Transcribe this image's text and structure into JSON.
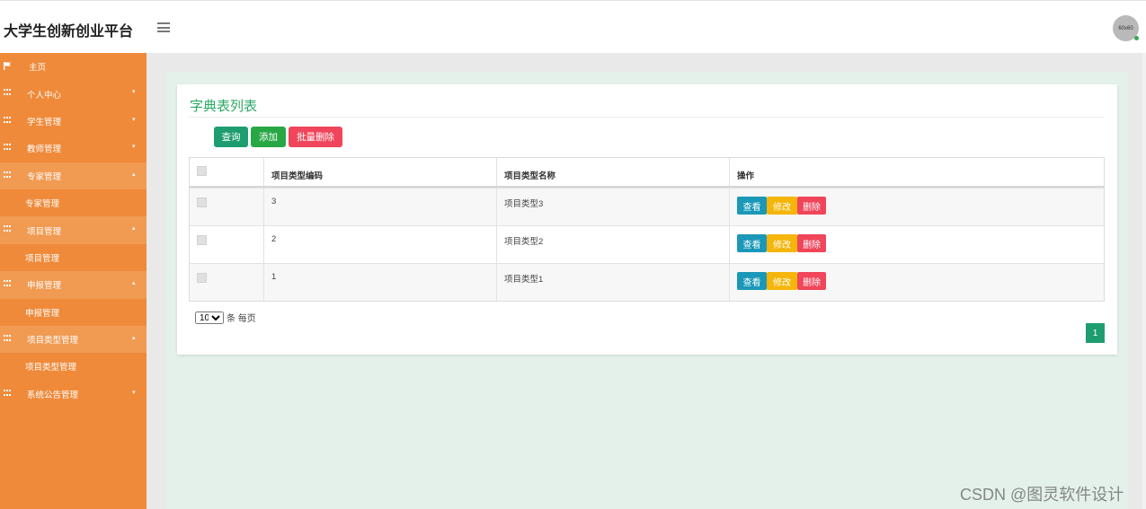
{
  "header": {
    "app_title": "大学生创新创业平台",
    "avatar_text": "60x60"
  },
  "sidebar": {
    "items": [
      {
        "label": "主页",
        "icon": "flag-icon",
        "type": "home"
      },
      {
        "label": "个人中心",
        "icon": "grid-icon",
        "chevron": "▾"
      },
      {
        "label": "学生管理",
        "icon": "grid-icon",
        "chevron": "▾"
      },
      {
        "label": "教师管理",
        "icon": "grid-icon",
        "chevron": "▾"
      },
      {
        "label": "专家管理",
        "icon": "grid-icon",
        "chevron": "▴",
        "open": true
      },
      {
        "label": "专家管理",
        "type": "sub"
      },
      {
        "label": "项目管理",
        "icon": "grid-icon",
        "chevron": "▴",
        "open": true
      },
      {
        "label": "项目管理",
        "type": "sub"
      },
      {
        "label": "申报管理",
        "icon": "grid-icon",
        "chevron": "▴",
        "open": true
      },
      {
        "label": "申报管理",
        "type": "sub"
      },
      {
        "label": "项目类型管理",
        "icon": "grid-icon",
        "chevron": "▴",
        "open": true
      },
      {
        "label": "项目类型管理",
        "type": "sub"
      },
      {
        "label": "系统公告管理",
        "icon": "grid-icon",
        "chevron": "▾"
      }
    ]
  },
  "main": {
    "title": "字典表列表",
    "buttons": {
      "query": "查询",
      "add": "添加",
      "batch_delete": "批量删除"
    },
    "table": {
      "columns": [
        "项目类型编码",
        "项目类型名称",
        "操作"
      ],
      "rows": [
        {
          "code": "3",
          "name": "项目类型3"
        },
        {
          "code": "2",
          "name": "项目类型2"
        },
        {
          "code": "1",
          "name": "项目类型1"
        }
      ],
      "actions": {
        "view": "查看",
        "edit": "修改",
        "delete": "删除"
      }
    },
    "pagination": {
      "page_size": "10",
      "page_size_options": [
        "10"
      ],
      "per_page_label": "条 每页",
      "current_page": "1"
    }
  },
  "watermark": "CSDN @图灵软件设计",
  "colors": {
    "sidebar": "#ef8a3a",
    "title_green": "#2aa864",
    "primary": "#1d9d70",
    "success": "#28a745",
    "danger": "#f0455a",
    "info": "#1b98b8",
    "warning": "#f5b50a"
  }
}
